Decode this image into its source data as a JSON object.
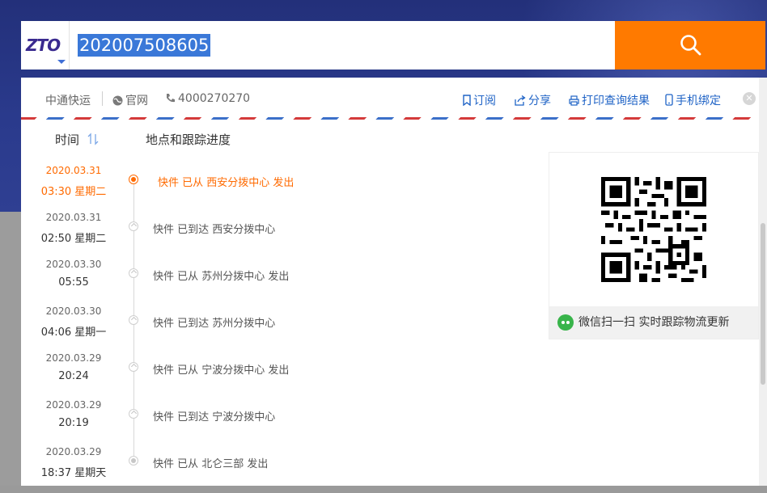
{
  "search": {
    "logo": "ZTO",
    "query": "202007508605"
  },
  "toolbar": {
    "company": "中通快运",
    "website": "官网",
    "phone": "4000270270",
    "subscribe": "订阅",
    "share": "分享",
    "print": "打印查询结果",
    "bind_phone": "手机绑定"
  },
  "columns": {
    "time": "时间",
    "progress": "地点和跟踪进度"
  },
  "events": [
    {
      "date": "2020.03.31",
      "time": "03:30  星期二",
      "desc": "快件 已从 西安分拨中心 发出"
    },
    {
      "date": "2020.03.31",
      "time": "02:50  星期二",
      "desc": "快件 已到达 西安分拨中心"
    },
    {
      "date": "2020.03.30",
      "time": "05:55",
      "desc": "快件 已从 苏州分拨中心 发出"
    },
    {
      "date": "2020.03.30",
      "time": "04:06  星期一",
      "desc": "快件 已到达 苏州分拨中心"
    },
    {
      "date": "2020.03.29",
      "time": "20:24",
      "desc": "快件 已从 宁波分拨中心 发出"
    },
    {
      "date": "2020.03.29",
      "time": "20:19",
      "desc": "快件 已到达 宁波分拨中心"
    },
    {
      "date": "2020.03.29",
      "time": "18:37  星期天",
      "desc": "快件 已从 北仑三部 发出"
    }
  ],
  "qr": {
    "caption": "微信扫一扫 实时跟踪物流更新"
  },
  "colors": {
    "accent": "#ff7a00",
    "active_event": "#ff6a00",
    "link": "#1f63c6",
    "brand": "#3a2a8f"
  }
}
